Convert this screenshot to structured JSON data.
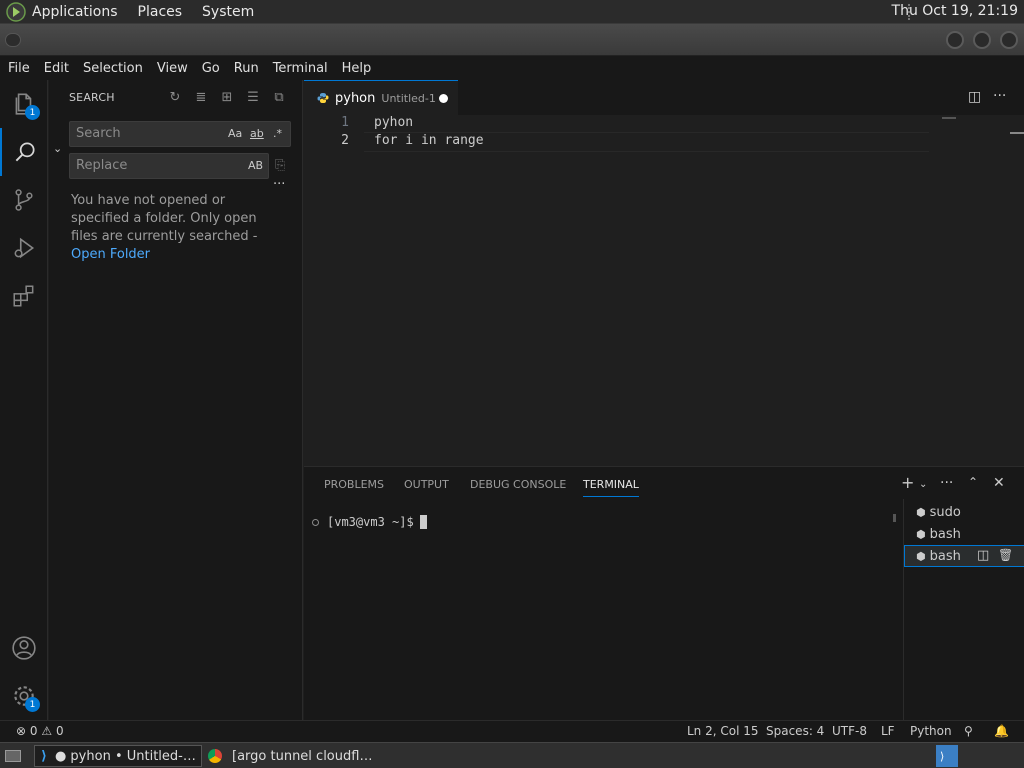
{
  "system_panel": {
    "menus": [
      "Applications",
      "Places",
      "System"
    ],
    "clock": "Thu Oct 19, 21:19"
  },
  "menubar": [
    "File",
    "Edit",
    "Selection",
    "View",
    "Go",
    "Run",
    "Terminal",
    "Help"
  ],
  "activity": {
    "explorer_badge": "1",
    "settings_badge": "1"
  },
  "sidebar": {
    "title": "SEARCH",
    "search_placeholder": "Search",
    "replace_placeholder": "Replace",
    "match_case": "Aa",
    "whole_word": "ab",
    "regex": ".*",
    "preserve_case": "AB",
    "message": "You have not opened or specified a folder. Only open files are currently searched - ",
    "open_folder_link": "Open Folder"
  },
  "editor": {
    "tab_name": "pyhon",
    "tab_description": "Untitled-1",
    "lines": [
      {
        "num": "1",
        "text": "pyhon"
      },
      {
        "num": "2",
        "text": "for i in range"
      }
    ]
  },
  "panel": {
    "tabs": [
      "PROBLEMS",
      "OUTPUT",
      "DEBUG CONSOLE",
      "TERMINAL"
    ],
    "active_tab": "TERMINAL",
    "prompt": "[vm3@vm3 ~]$",
    "terminals": [
      "sudo",
      "bash",
      "bash"
    ]
  },
  "statusbar": {
    "errors": "0",
    "warnings": "0",
    "position": "Ln 2, Col 15",
    "spaces": "Spaces: 4",
    "encoding": "UTF-8",
    "eol": "LF",
    "language": "Python"
  },
  "taskbar": {
    "item1": "● pyhon • Untitled-…",
    "item2": "[argo tunnel cloudfl…"
  },
  "colors": {
    "accent": "#0078d4",
    "link": "#4daafc",
    "background": "#1f1f1f",
    "sidebar": "#181818"
  }
}
